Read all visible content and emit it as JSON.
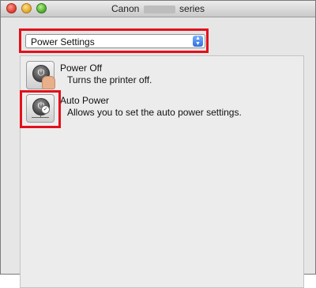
{
  "window": {
    "title_prefix": "Canon",
    "title_suffix": "series"
  },
  "selector": {
    "value": "Power Settings",
    "arrows_icon": "up-down-arrows-icon"
  },
  "items": [
    {
      "title": "Power Off",
      "description": "Turns the printer off.",
      "icon": "power-off-hand-icon"
    },
    {
      "title": "Auto Power",
      "description": "Allows you to set the auto power settings.",
      "icon": "auto-power-icon"
    }
  ],
  "colors": {
    "highlight": "#e3101a"
  }
}
